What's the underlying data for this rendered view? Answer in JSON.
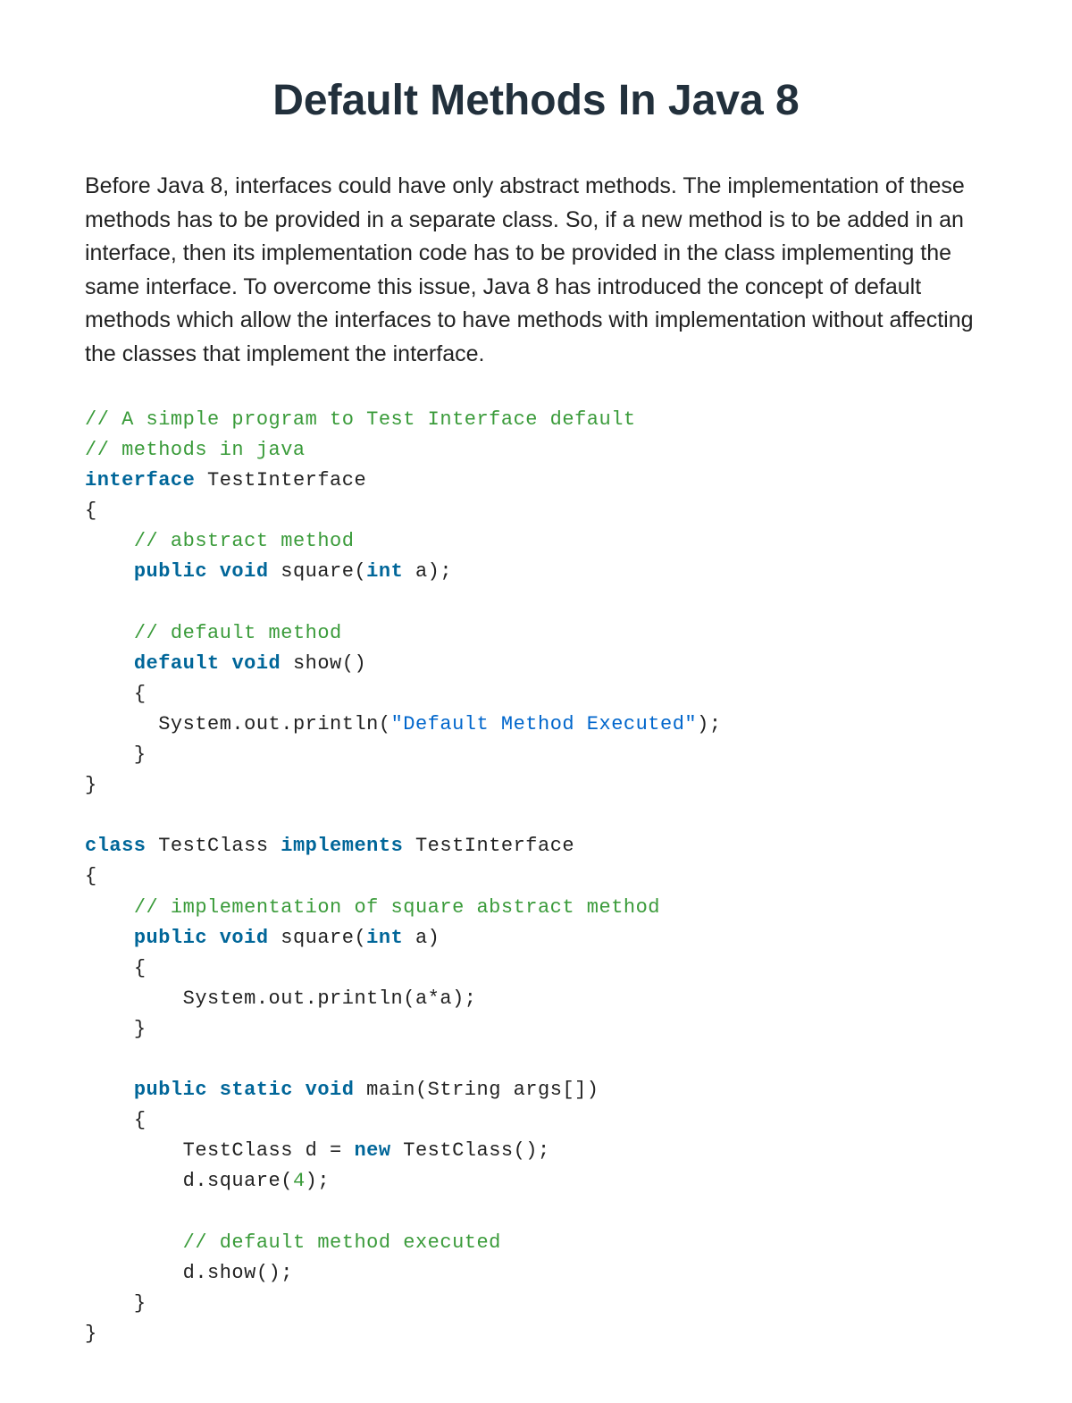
{
  "title": "Default Methods In Java 8",
  "intro": "Before Java 8, interfaces could have only abstract methods. The implementation of these methods has to be provided in a separate class. So, if a new method is to be added in an interface, then its implementation code has to be provided in the class implementing the same interface. To overcome this issue, Java 8 has introduced the concept of default methods which allow the interfaces to have methods with implementation without affecting the classes that implement the interface.",
  "code": {
    "c1": "// A simple program to Test Interface default",
    "c2": "// methods in java",
    "kw_interface": "interface",
    "iface_name": " TestInterface",
    "lbrace": "{",
    "rbrace": "}",
    "c3": "// abstract method",
    "kw_public": "public",
    "kw_void": "void",
    "kw_int": "int",
    "m_square_sig_pre": " square(",
    "m_square_sig_post": " a);",
    "c4": "// default method",
    "kw_default": "default",
    "m_show_sig": " show()",
    "println_pre": "System.out.println(",
    "str_default": "\"Default Method Executed\"",
    "paren_semi": ");",
    "kw_class": "class",
    "class_name": " TestClass ",
    "kw_implements": "implements",
    "iface_ref": " TestInterface",
    "c5": "// implementation of square abstract method",
    "m_square2_sig_pre": " square(",
    "m_square2_sig_post": " a)",
    "println_aa": "System.out.println(a*a);",
    "kw_static": "static",
    "m_main_sig": " main(String args[])",
    "testclass_decl_pre": "TestClass d = ",
    "kw_new": "new",
    "testclass_decl_post": " TestClass();",
    "call_square_pre": "d.square(",
    "num_4": "4",
    "c6": "// default method executed",
    "call_show": "d.show();"
  }
}
